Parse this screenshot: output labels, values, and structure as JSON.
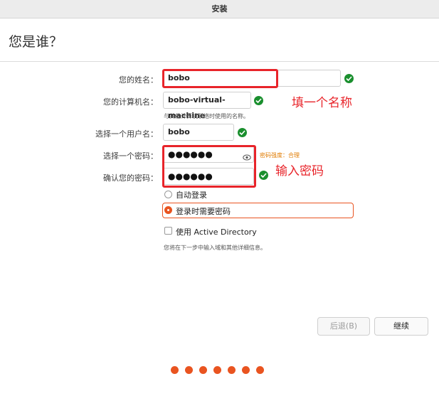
{
  "window": {
    "title": "安装"
  },
  "page": {
    "title": "您是谁？"
  },
  "form": {
    "name_label": "您的姓名：",
    "name_value": "bobo",
    "computer_label": "您的计算机名：",
    "computer_value": "bobo-virtual-machine",
    "computer_hint": "与其他计算机联络时使用的名称。",
    "username_label": "选择一个用户名：",
    "username_value": "bobo",
    "password_label": "选择一个密码：",
    "password_value": "●●●●●●",
    "password_strength": "密码强度：合理",
    "confirm_label": "确认您的密码：",
    "confirm_value": "●●●●●●"
  },
  "login_options": {
    "auto_login": "自动登录",
    "require_password": "登录时需要密码",
    "selected": "require_password"
  },
  "active_directory": {
    "label": "使用 Active Directory",
    "checked": false,
    "hint": "您将在下一步中输入域和其他详细信息。"
  },
  "annotations": {
    "name_note": "填一个名称",
    "password_note": "输入密码"
  },
  "buttons": {
    "back": "后退(B)",
    "continue": "继续"
  },
  "progress": {
    "steps": 7
  },
  "colors": {
    "accent": "#e95420",
    "check": "#1a8f2e",
    "annotation": "#e8242a"
  }
}
